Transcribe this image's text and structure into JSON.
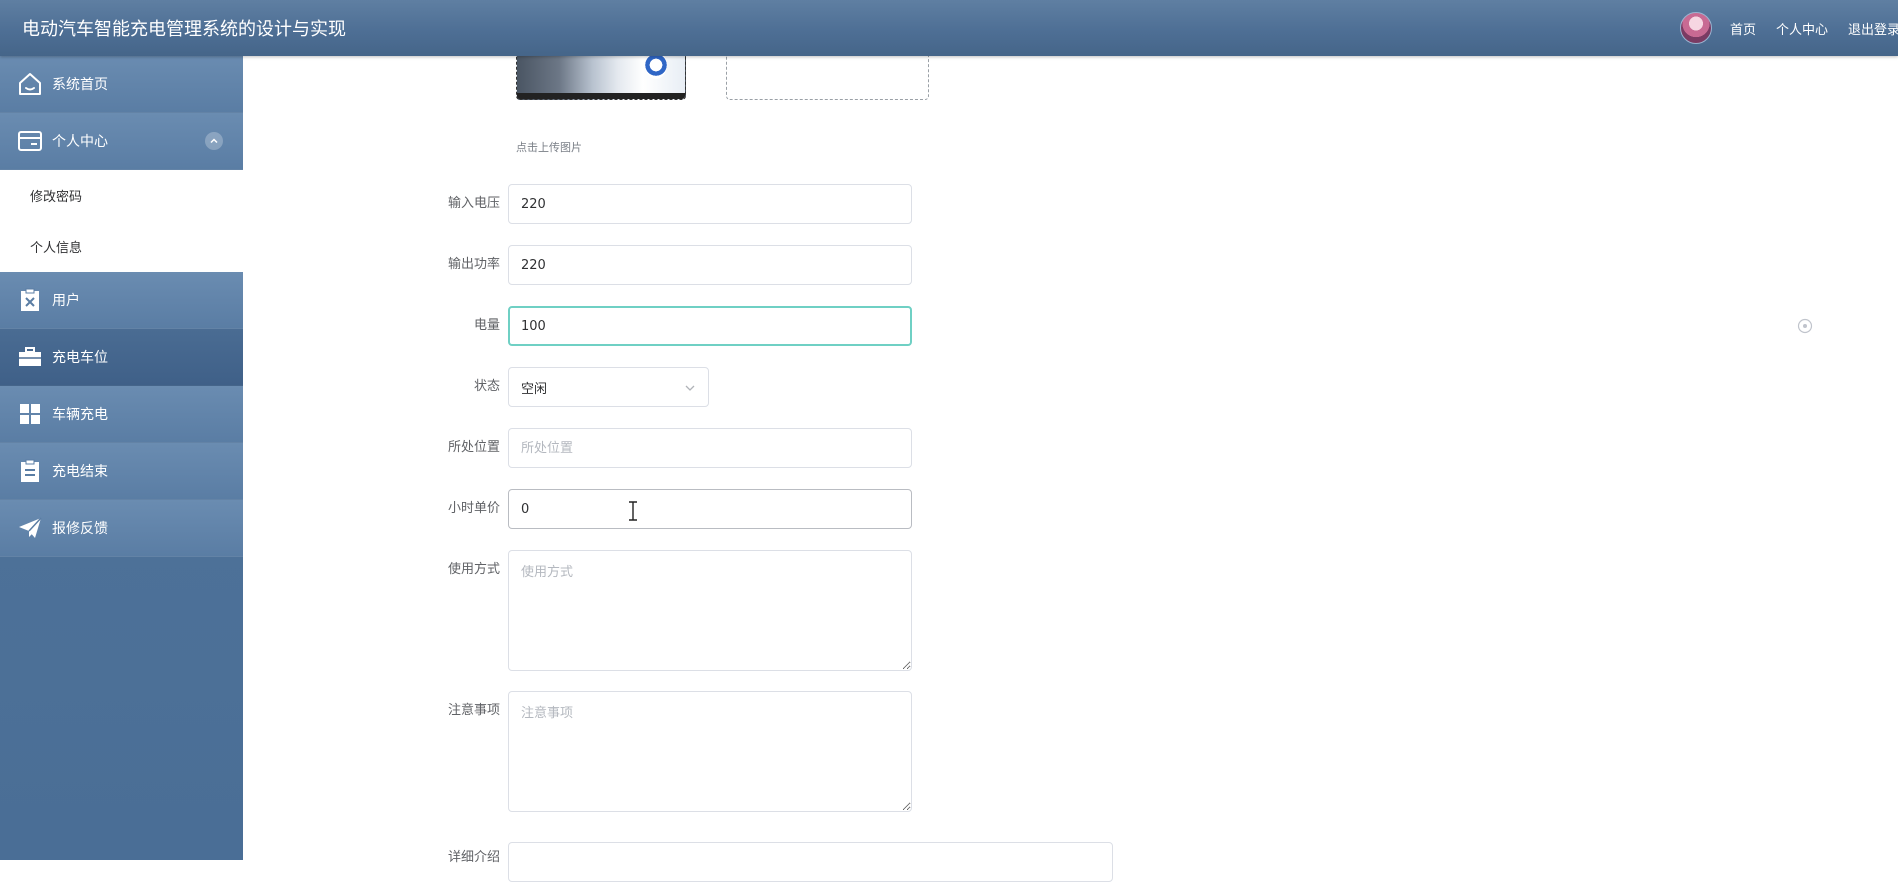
{
  "app": {
    "title": "电动汽车智能充电管理系统的设计与实现"
  },
  "header": {
    "links": [
      {
        "label": "首页"
      },
      {
        "label": "个人中心"
      },
      {
        "label": "退出登录"
      }
    ]
  },
  "sidebar": {
    "items": [
      {
        "label": "系统首页",
        "icon": "home-icon"
      },
      {
        "label": "个人中心",
        "icon": "wallet-icon",
        "expanded": true,
        "children": [
          {
            "label": "修改密码"
          },
          {
            "label": "个人信息"
          }
        ]
      },
      {
        "label": "用户",
        "icon": "clipboard-x-icon"
      },
      {
        "label": "充电车位",
        "icon": "briefcase-icon",
        "active": true
      },
      {
        "label": "车辆充电",
        "icon": "grid-icon"
      },
      {
        "label": "充电结束",
        "icon": "clipboard-icon"
      },
      {
        "label": "报修反馈",
        "icon": "paper-plane-icon"
      }
    ]
  },
  "form": {
    "upload_hint": "点击上传图片",
    "fields": {
      "input_voltage": {
        "label": "输入电压",
        "value": "220"
      },
      "output_power": {
        "label": "输出功率",
        "value": "220"
      },
      "charge_level": {
        "label": "电量",
        "value": "100"
      },
      "status": {
        "label": "状态",
        "value": "空闲"
      },
      "location": {
        "label": "所处位置",
        "value": "",
        "placeholder": "所处位置"
      },
      "hourly_price": {
        "label": "小时单价",
        "value": "0"
      },
      "usage": {
        "label": "使用方式",
        "value": "",
        "placeholder": "使用方式"
      },
      "notes": {
        "label": "注意事项",
        "value": "",
        "placeholder": "注意事项"
      },
      "details": {
        "label": "详细介绍"
      }
    }
  },
  "colors": {
    "header": "#4e6f95",
    "sidebar": "#5a7da4",
    "sidebar_active": "#3f6088",
    "focus_border": "#6fd0c4"
  }
}
